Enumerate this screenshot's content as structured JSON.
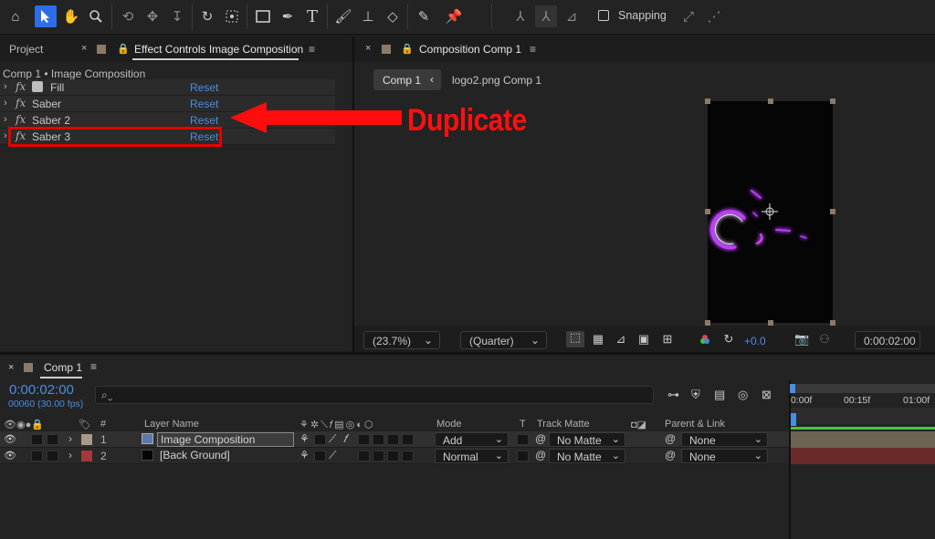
{
  "toolbar": {
    "tools": [
      "home-icon",
      "selection-icon",
      "hand-icon",
      "zoom-icon",
      "orbit-camera-icon",
      "pan-camera-icon",
      "dolly-camera-icon",
      "rotate-icon",
      "anchor-point-icon",
      "rectangle-icon",
      "pen-icon",
      "text-icon",
      "brush-icon",
      "clone-stamp-icon",
      "eraser-icon",
      "roto-brush-icon",
      "puppet-pin-icon"
    ],
    "snapping_label": "Snapping"
  },
  "left_panel": {
    "tab_project": "Project",
    "tab_effect_controls": "Effect Controls Image Composition",
    "title": "Comp 1 • Image Composition",
    "effects": [
      {
        "name": "Fill",
        "reset": "Reset"
      },
      {
        "name": "Saber",
        "reset": "Reset"
      },
      {
        "name": "Saber 2",
        "reset": "Reset"
      },
      {
        "name": "Saber 3",
        "reset": "Reset"
      }
    ]
  },
  "annotation": {
    "label": "Duplicate",
    "color": "#ff0d0d"
  },
  "comp_panel": {
    "tab": "Composition Comp 1",
    "breadcrumb_active": "Comp 1",
    "breadcrumb_next": "logo2.png Comp 1",
    "zoom": "(23.7%)",
    "resolution": "(Quarter)",
    "exposure": "+0.0",
    "timecode": "0:00:02:00"
  },
  "timeline": {
    "tab": "Comp 1",
    "timecode": "0:00:02:00",
    "frames_fps": "00060 (30.00 fps)",
    "ruler": [
      "0:00f",
      "00:15f",
      "01:00f"
    ],
    "columns": {
      "hash": "#",
      "layer_name": "Layer Name",
      "mode": "Mode",
      "t": "T",
      "track_matte": "Track Matte",
      "parent": "Parent & Link"
    },
    "layers": [
      {
        "num": "1",
        "name": "Image Composition",
        "mode": "Add",
        "matte": "No Matte",
        "parent": "None",
        "label_color": "#a89a86",
        "bar_color": "#6b6452"
      },
      {
        "num": "2",
        "name": "[Back Ground]",
        "mode": "Normal",
        "matte": "No Matte",
        "parent": "None",
        "label_color": "#a33a3a",
        "bar_color": "#6a2a2a"
      }
    ]
  }
}
